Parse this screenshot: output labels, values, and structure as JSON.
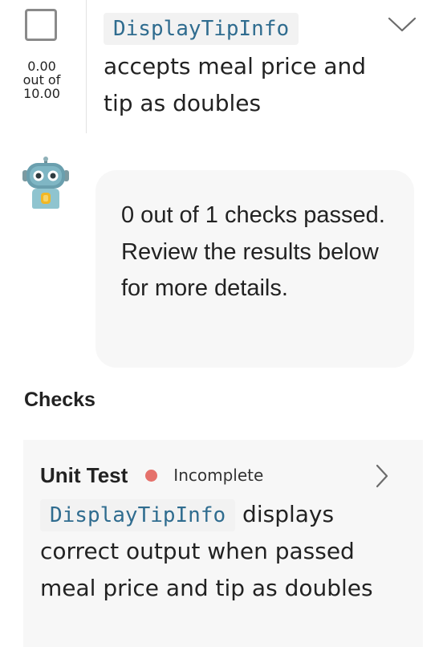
{
  "item": {
    "function_name": "DisplayTipInfo",
    "description": " accepts meal price and tip as doubles",
    "score": {
      "value": "0.00",
      "out_of_label": "out of",
      "max": "10.00"
    },
    "icons": {
      "checkbox": "checkbox-empty",
      "expand": "chevron-down-icon"
    }
  },
  "assistant": {
    "avatar": "robot-avatar",
    "message": "0 out of 1 checks passed. Review the results below for more details."
  },
  "checks": {
    "heading": "Checks",
    "items": [
      {
        "type": "Unit Test",
        "status": "Incomplete",
        "status_color": "#e5716b",
        "function_name": "DisplayTipInfo",
        "description": " displays correct output when passed meal price and tip as doubles",
        "icon": "chevron-right-icon"
      }
    ]
  },
  "colors": {
    "code_text": "#2f6c8f",
    "code_bg": "#f2f2f2",
    "card_bg": "#f7f7f7"
  }
}
